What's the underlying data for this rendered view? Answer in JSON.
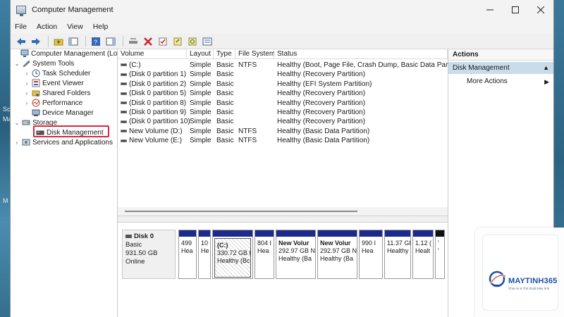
{
  "desktop": {
    "left_text": [
      "Sc",
      "Ma",
      "M"
    ]
  },
  "window": {
    "title": "Computer Management"
  },
  "menu": [
    "File",
    "Action",
    "View",
    "Help"
  ],
  "tree": {
    "root": "Computer Management (Local",
    "system_tools": "System Tools",
    "task_scheduler": "Task Scheduler",
    "event_viewer": "Event Viewer",
    "shared_folders": "Shared Folders",
    "performance": "Performance",
    "device_manager": "Device Manager",
    "storage": "Storage",
    "disk_management": "Disk Management",
    "services": "Services and Applications"
  },
  "volumes": {
    "headers": [
      "Volume",
      "Layout",
      "Type",
      "File System",
      "Status"
    ],
    "rows": [
      [
        "(C:)",
        "Simple",
        "Basic",
        "NTFS",
        "Healthy (Boot, Page File, Crash Dump, Basic Data Partitio"
      ],
      [
        "(Disk 0 partition 1)",
        "Simple",
        "Basic",
        "",
        "Healthy (Recovery Partition)"
      ],
      [
        "(Disk 0 partition 2)",
        "Simple",
        "Basic",
        "",
        "Healthy (EFI System Partition)"
      ],
      [
        "(Disk 0 partition 5)",
        "Simple",
        "Basic",
        "",
        "Healthy (Recovery Partition)"
      ],
      [
        "(Disk 0 partition 8)",
        "Simple",
        "Basic",
        "",
        "Healthy (Recovery Partition)"
      ],
      [
        "(Disk 0 partition 9)",
        "Simple",
        "Basic",
        "",
        "Healthy (Recovery Partition)"
      ],
      [
        "(Disk 0 partition 10)",
        "Simple",
        "Basic",
        "",
        "Healthy (Recovery Partition)"
      ],
      [
        "New Volume (D:)",
        "Simple",
        "Basic",
        "NTFS",
        "Healthy (Basic Data Partition)"
      ],
      [
        "New Volume (E:)",
        "Simple",
        "Basic",
        "NTFS",
        "Healthy (Basic Data Partition)"
      ]
    ]
  },
  "disk": {
    "name": "Disk 0",
    "type": "Basic",
    "size": "931.50 GB",
    "state": "Online"
  },
  "partitions": [
    {
      "l1": "",
      "l2": "499",
      "l3": "Hea"
    },
    {
      "l1": "",
      "l2": "10",
      "l3": "He"
    },
    {
      "l1": "(C:)",
      "l2": "330.72 GB N",
      "l3": "Healthy (Bc"
    },
    {
      "l1": "",
      "l2": "804 I",
      "l3": "Hea"
    },
    {
      "l1": "New Volur",
      "l2": "292.97 GB N",
      "l3": "Healthy (Ba"
    },
    {
      "l1": "New Volur",
      "l2": "292.97 GB N",
      "l3": "Healthy (Ba"
    },
    {
      "l1": "",
      "l2": "990 I",
      "l3": "Hea"
    },
    {
      "l1": "",
      "l2": "11.37 GI",
      "l3": "Healthy"
    },
    {
      "l1": "",
      "l2": "1.12 (",
      "l3": "Healt"
    },
    {
      "l1": "",
      "l2": "'",
      "l3": "'"
    }
  ],
  "actions": {
    "header": "Actions",
    "selected": "Disk Management",
    "more": "More Actions"
  },
  "watermark": {
    "brand": "MAYTINH365",
    "tagline": "Chia sẻ & Thủ thuật Máy tính"
  },
  "colors": {
    "partition_bar": "#1c2a8c",
    "highlight_box": "#d9263d",
    "actions_selected": "#c9dcea"
  }
}
